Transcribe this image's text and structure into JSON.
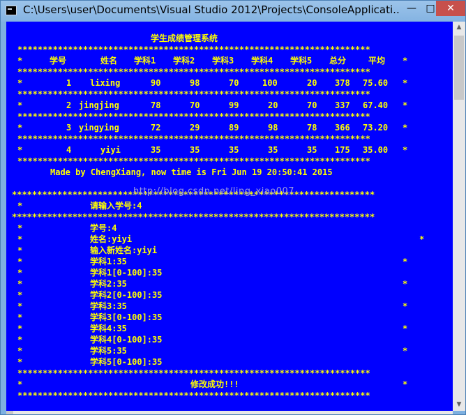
{
  "window": {
    "title": "C:\\Users\\user\\Documents\\Visual Studio 2012\\Projects\\ConsoleApplicati...",
    "minimize_glyph": "—",
    "maximize_glyph": "□",
    "close_glyph": "✕"
  },
  "console": {
    "heading": "学生成绩管理系统",
    "stars_line": "**********************************************************************",
    "stars_line_long": "************************************************************************",
    "table": {
      "columns": [
        "学号",
        "姓名",
        "学科1",
        "学科2",
        "学科3",
        "学科4",
        "学科5",
        "总分",
        "平均"
      ],
      "rows": [
        [
          "1",
          "lixing",
          "90",
          "98",
          "70",
          "100",
          "20",
          "378",
          "75.60"
        ],
        [
          "2",
          "jingjing",
          "78",
          "70",
          "99",
          "20",
          "70",
          "337",
          "67.40"
        ],
        [
          "3",
          "yingying",
          "72",
          "29",
          "89",
          "98",
          "78",
          "366",
          "73.20"
        ],
        [
          "4",
          "yiyi",
          "35",
          "35",
          "35",
          "35",
          "35",
          "175",
          "35.00"
        ]
      ]
    },
    "footer_credit": "Made by ChengXiang, now time is Fri Jun 19 20:50:41 2015",
    "prompt_input_id": "请输入学号:4",
    "detail_lines": [
      "学号:4",
      "姓名:yiyi",
      "输入新姓名:yiyi",
      "学科1:35",
      "学科1[0-100]:35",
      "学科2:35",
      "学科2[0-100]:35",
      "学科3:35",
      "学科3[0-100]:35",
      "学科4:35",
      "学科4[0-100]:35",
      "学科5:35",
      "学科5[0-100]:35"
    ],
    "success_message": "修改成功!!!",
    "star_char": "*",
    "watermark": "http://blog.csdn.net/ling_xiao007"
  },
  "colors": {
    "console_bg": "#0000ff",
    "console_fg": "#ffff00"
  }
}
